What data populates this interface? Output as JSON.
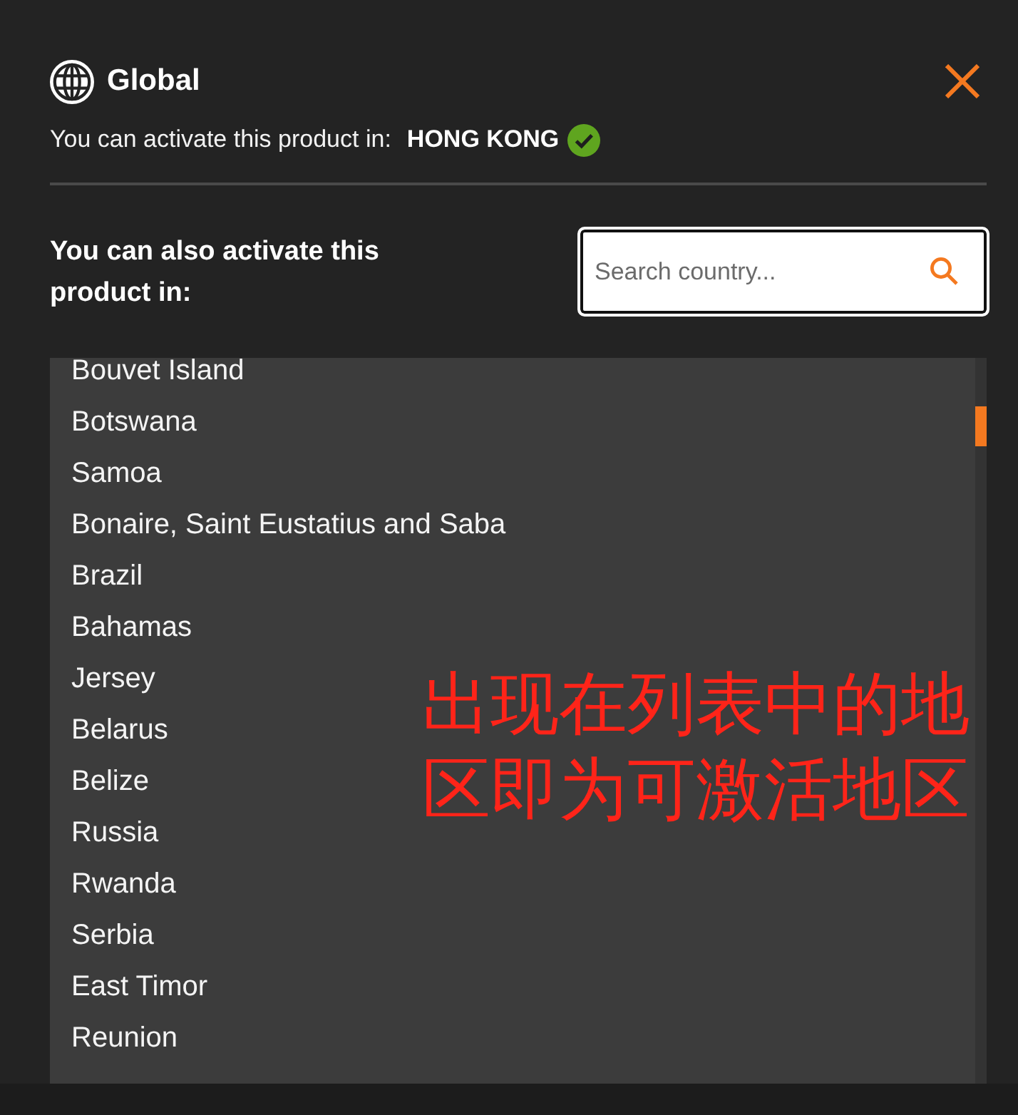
{
  "dialog": {
    "title": "Global"
  },
  "primary": {
    "label": "You can activate this product in:",
    "country": "HONG KONG",
    "verified": true
  },
  "secondary": {
    "label": "You can also activate this product in:",
    "search": {
      "placeholder": "Search country..."
    }
  },
  "countries": [
    "Bouvet Island",
    "Botswana",
    "Samoa",
    "Bonaire, Saint Eustatius and Saba",
    "Brazil",
    "Bahamas",
    "Jersey",
    "Belarus",
    "Belize",
    "Russia",
    "Rwanda",
    "Serbia",
    "East Timor",
    "Reunion"
  ],
  "annotation": {
    "text": "出现在列表中的地区即为可激活地区"
  }
}
